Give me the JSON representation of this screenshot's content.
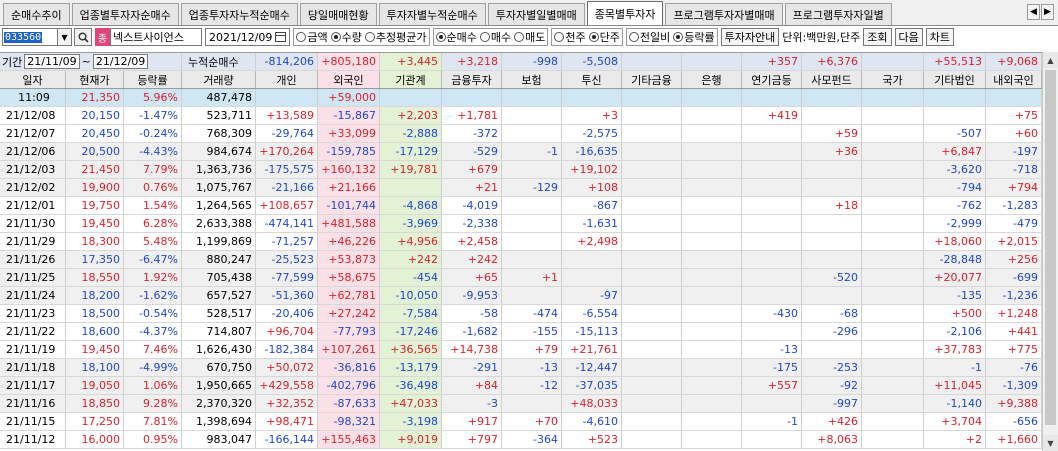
{
  "tabs": [
    {
      "label": "순매수추이",
      "active": false
    },
    {
      "label": "업종별투자자순매수",
      "active": false
    },
    {
      "label": "업종투자자누적순매수",
      "active": false
    },
    {
      "label": "당일매매현황",
      "active": false
    },
    {
      "label": "투자자별누적순매수",
      "active": false
    },
    {
      "label": "투자자별일별매매",
      "active": false
    },
    {
      "label": "종목별투자자",
      "active": true
    },
    {
      "label": "프로그램투자자별매매",
      "active": false
    },
    {
      "label": "프로그램투자자일별",
      "active": false
    }
  ],
  "toolbar": {
    "stock_code": "033560",
    "stock_badge": "종",
    "stock_name": "넥스트사이언스",
    "date": "2021/12/09",
    "value_type": [
      {
        "label": "금액",
        "selected": false
      },
      {
        "label": "수량",
        "selected": true
      },
      {
        "label": "추정평균가",
        "selected": false
      }
    ],
    "trade_type": [
      {
        "label": "순매수",
        "selected": true
      },
      {
        "label": "매수",
        "selected": false
      },
      {
        "label": "매도",
        "selected": false
      }
    ],
    "share_unit": [
      {
        "label": "천주",
        "selected": false
      },
      {
        "label": "단주",
        "selected": true
      }
    ],
    "compare": [
      {
        "label": "전일비",
        "selected": false
      },
      {
        "label": "등락률",
        "selected": true
      }
    ],
    "guide_button": "투자자안내",
    "unit_text": "단위:백만원,단주",
    "query_button": "조회",
    "next_button": "다음",
    "chart_button": "차트"
  },
  "period": {
    "label": "기간",
    "from": "21/11/09",
    "to": "21/12/09",
    "cum_label": "누적순매수",
    "values": [
      "",
      "",
      "",
      "-814,206",
      "+805,180",
      "+3,445",
      "+3,218",
      "-998",
      "-5,508",
      "",
      "",
      "+357",
      "+6,376",
      "",
      "+55,513",
      "+9,068"
    ]
  },
  "columns": [
    "일자",
    "현재가",
    "등락률",
    "거래량",
    "개인",
    "외국인",
    "기관계",
    "금융투자",
    "보험",
    "투신",
    "기타금융",
    "은행",
    "연기금등",
    "사모펀드",
    "국가",
    "기타법인",
    "내외국인"
  ],
  "rows": [
    [
      "11:09",
      "21,350",
      "5.96%",
      "487,478",
      "",
      "+59,000",
      "",
      "",
      "",
      "",
      "",
      "",
      "",
      "",
      "",
      "",
      ""
    ],
    [
      "21/12/08",
      "20,150",
      "-1.47%",
      "523,711",
      "+13,589",
      "-15,867",
      "+2,203",
      "+1,781",
      "",
      "+3",
      "",
      "",
      "+419",
      "",
      "",
      "",
      "+75"
    ],
    [
      "21/12/07",
      "20,450",
      "-0.24%",
      "768,309",
      "-29,764",
      "+33,099",
      "-2,888",
      "-372",
      "",
      "-2,575",
      "",
      "",
      "",
      "+59",
      "",
      "-507",
      "+60"
    ],
    [
      "21/12/06",
      "20,500",
      "-4.43%",
      "984,674",
      "+170,264",
      "-159,785",
      "-17,129",
      "-529",
      "-1",
      "-16,635",
      "",
      "",
      "",
      "+36",
      "",
      "+6,847",
      "-197"
    ],
    [
      "21/12/03",
      "21,450",
      "7.79%",
      "1,363,736",
      "-175,575",
      "+160,132",
      "+19,781",
      "+679",
      "",
      "+19,102",
      "",
      "",
      "",
      "",
      "",
      "-3,620",
      "-718"
    ],
    [
      "21/12/02",
      "19,900",
      "0.76%",
      "1,075,767",
      "-21,166",
      "+21,166",
      "",
      "+21",
      "-129",
      "+108",
      "",
      "",
      "",
      "",
      "",
      "-794",
      "+794"
    ],
    [
      "21/12/01",
      "19,750",
      "1.54%",
      "1,264,565",
      "+108,657",
      "-101,744",
      "-4,868",
      "-4,019",
      "",
      "-867",
      "",
      "",
      "",
      "+18",
      "",
      "-762",
      "-1,283"
    ],
    [
      "21/11/30",
      "19,450",
      "6.28%",
      "2,633,388",
      "-474,141",
      "+481,588",
      "-3,969",
      "-2,338",
      "",
      "-1,631",
      "",
      "",
      "",
      "",
      "",
      "-2,999",
      "-479"
    ],
    [
      "21/11/29",
      "18,300",
      "5.48%",
      "1,199,869",
      "-71,257",
      "+46,226",
      "+4,956",
      "+2,458",
      "",
      "+2,498",
      "",
      "",
      "",
      "",
      "",
      "+18,060",
      "+2,015"
    ],
    [
      "21/11/26",
      "17,350",
      "-6.47%",
      "880,247",
      "-25,523",
      "+53,873",
      "+242",
      "+242",
      "",
      "",
      "",
      "",
      "",
      "",
      "",
      "-28,848",
      "+256"
    ],
    [
      "21/11/25",
      "18,550",
      "1.92%",
      "705,438",
      "-77,599",
      "+58,675",
      "-454",
      "+65",
      "+1",
      "",
      "",
      "",
      "",
      "-520",
      "",
      "+20,077",
      "-699"
    ],
    [
      "21/11/24",
      "18,200",
      "-1.62%",
      "657,527",
      "-51,360",
      "+62,781",
      "-10,050",
      "-9,953",
      "",
      "-97",
      "",
      "",
      "",
      "",
      "",
      "-135",
      "-1,236"
    ],
    [
      "21/11/23",
      "18,500",
      "-0.54%",
      "528,517",
      "-20,406",
      "+27,242",
      "-7,584",
      "-58",
      "-474",
      "-6,554",
      "",
      "",
      "-430",
      "-68",
      "",
      "+500",
      "+1,248"
    ],
    [
      "21/11/22",
      "18,600",
      "-4.37%",
      "714,807",
      "+96,704",
      "-77,793",
      "-17,246",
      "-1,682",
      "-155",
      "-15,113",
      "",
      "",
      "",
      "-296",
      "",
      "-2,106",
      "+441"
    ],
    [
      "21/11/19",
      "19,450",
      "7.46%",
      "1,626,430",
      "-182,384",
      "+107,261",
      "+36,565",
      "+14,738",
      "+79",
      "+21,761",
      "",
      "",
      "-13",
      "",
      "",
      "+37,783",
      "+775"
    ],
    [
      "21/11/18",
      "18,100",
      "-4.99%",
      "670,750",
      "+50,072",
      "-36,816",
      "-13,179",
      "-291",
      "-13",
      "-12,447",
      "",
      "",
      "-175",
      "-253",
      "",
      "-1",
      "-76"
    ],
    [
      "21/11/17",
      "19,050",
      "1.06%",
      "1,950,665",
      "+429,558",
      "-402,796",
      "-36,498",
      "+84",
      "-12",
      "-37,035",
      "",
      "",
      "+557",
      "-92",
      "",
      "+11,045",
      "-1,309"
    ],
    [
      "21/11/16",
      "18,850",
      "9.28%",
      "2,370,320",
      "+32,352",
      "-87,633",
      "+47,033",
      "-3",
      "",
      "+48,033",
      "",
      "",
      "",
      "-997",
      "",
      "-1,140",
      "+9,388"
    ],
    [
      "21/11/15",
      "17,250",
      "7.81%",
      "1,398,694",
      "+98,471",
      "-98,321",
      "-3,198",
      "+917",
      "+70",
      "-4,610",
      "",
      "",
      "-1",
      "+426",
      "",
      "+3,704",
      "-656"
    ],
    [
      "21/11/12",
      "16,000",
      "0.95%",
      "983,047",
      "-166,144",
      "+155,463",
      "+9,019",
      "+797",
      "-364",
      "+523",
      "",
      "",
      "",
      "+8,063",
      "",
      "+2",
      "+1,660"
    ]
  ],
  "colors": {
    "up": "#e0202a",
    "down": "#1f47d6",
    "header_bg": "#eaeaea",
    "period_bg": "#dfe6f2",
    "current_row_bg": "#cfe6f5",
    "foreign_col_bg": "#fbe1e7",
    "inst_col_bg": "#e3f2d5"
  }
}
